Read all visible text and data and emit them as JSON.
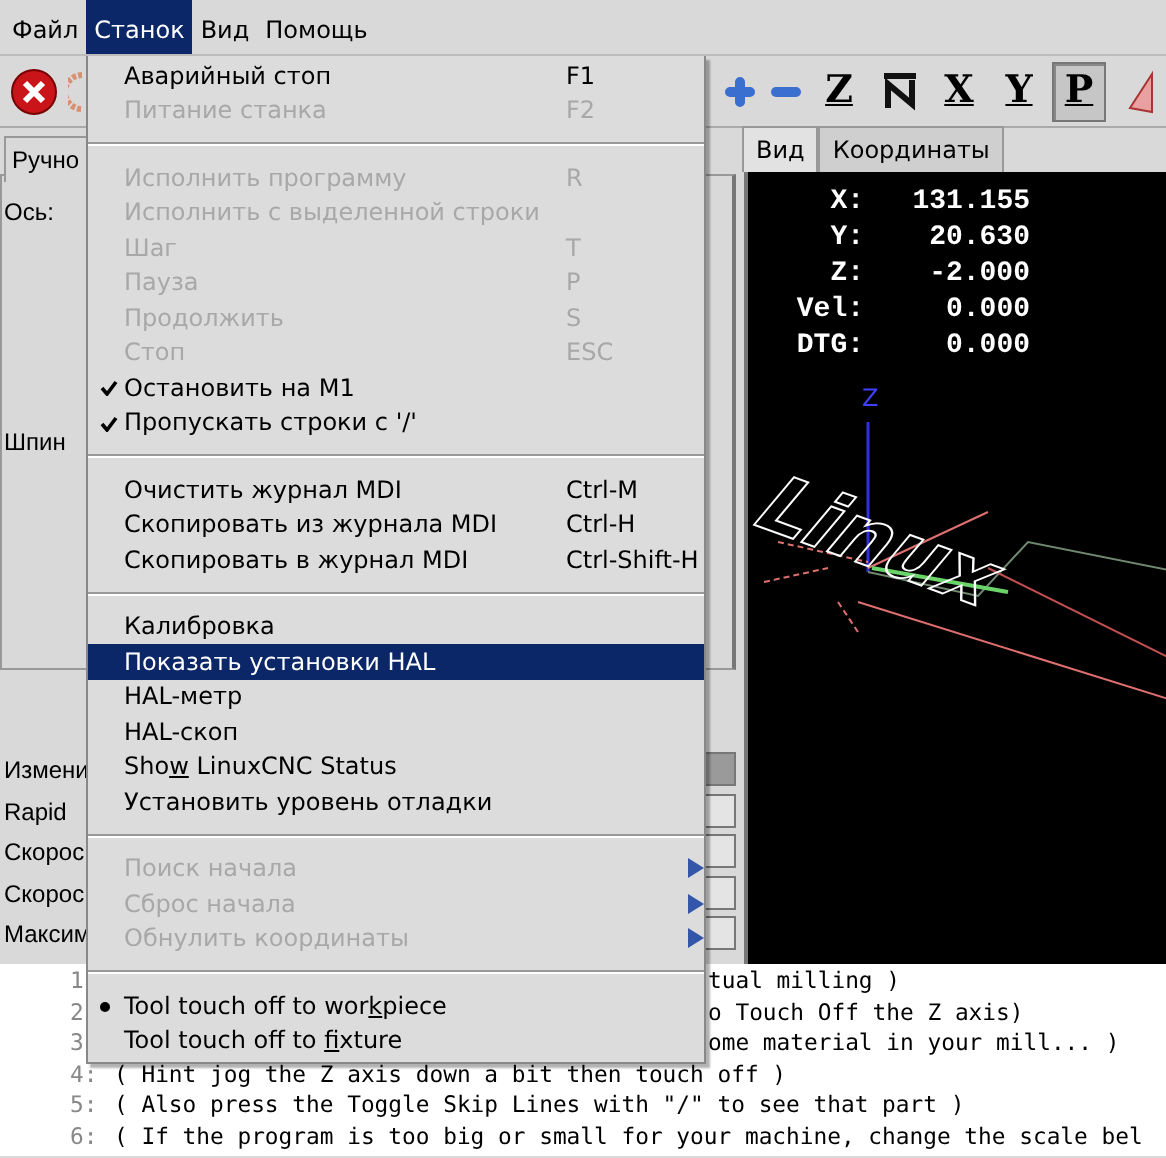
{
  "menubar": [
    {
      "label": "Файл",
      "selected": false
    },
    {
      "label": "Станок",
      "selected": true
    },
    {
      "label": "Вид",
      "selected": false
    },
    {
      "label": "Помощь",
      "selected": false
    }
  ],
  "toolbar": {
    "left": [
      {
        "kind": "estop"
      },
      {
        "kind": "power"
      }
    ],
    "right": [
      {
        "kind": "plus",
        "pressed": false
      },
      {
        "kind": "minus",
        "pressed": false
      },
      {
        "kind": "letter",
        "label": "Z",
        "pressed": false
      },
      {
        "kind": "rotated",
        "pressed": false
      },
      {
        "kind": "letter",
        "label": "X",
        "pressed": false
      },
      {
        "kind": "letter",
        "label": "Y",
        "pressed": false
      },
      {
        "kind": "letter",
        "label": "P",
        "pressed": true
      },
      {
        "kind": "cone",
        "pressed": false
      }
    ]
  },
  "left_panel": {
    "tab": "Ручно",
    "axis_label": "Ось:",
    "spindle_label": "Шпин",
    "sliders": [
      {
        "label": "Измени",
        "level": 1
      },
      {
        "label": "Rapid",
        "level": 0
      },
      {
        "label": "Скорос",
        "level": 0
      },
      {
        "label": "Скорос",
        "level": 0
      },
      {
        "label": "Максим",
        "level": 0
      }
    ]
  },
  "right_tabs": [
    {
      "label": "Вид",
      "selected": true
    },
    {
      "label": "Координаты",
      "selected": false
    }
  ],
  "dro": [
    {
      "axis": "X:",
      "value": "131.155"
    },
    {
      "axis": "Y:",
      "value": "20.630"
    },
    {
      "axis": "Z:",
      "value": "-2.000"
    },
    {
      "axis": "Vel:",
      "value": "0.000"
    },
    {
      "axis": "DTG:",
      "value": "0.000"
    }
  ],
  "preview": {
    "axis_label": "Z",
    "toolpath_text": "Linux"
  },
  "menu": [
    {
      "kind": "item",
      "label": "Аварийный стоп",
      "shortcut": "F1",
      "disabled": false,
      "selected": false
    },
    {
      "kind": "item",
      "label": "Питание станка",
      "shortcut": "F2",
      "disabled": true,
      "selected": false
    },
    {
      "kind": "separator"
    },
    {
      "kind": "item",
      "label": "Исполнить программу",
      "shortcut": "R",
      "disabled": true,
      "selected": false
    },
    {
      "kind": "item",
      "label": "Исполнить с выделенной строки",
      "disabled": true,
      "selected": false
    },
    {
      "kind": "item",
      "label": "Шаг",
      "shortcut": "T",
      "disabled": true,
      "selected": false
    },
    {
      "kind": "item",
      "label": "Пауза",
      "shortcut": "P",
      "disabled": true,
      "selected": false
    },
    {
      "kind": "item",
      "label": "Продолжить",
      "shortcut": "S",
      "disabled": true,
      "selected": false
    },
    {
      "kind": "item",
      "label": "Стоп",
      "shortcut": "ESC",
      "disabled": true,
      "selected": false
    },
    {
      "kind": "check",
      "label": "Остановить на M1",
      "checked": true,
      "disabled": false,
      "selected": false
    },
    {
      "kind": "check",
      "label": "Пропускать строки с '/'",
      "checked": true,
      "disabled": false,
      "selected": false
    },
    {
      "kind": "separator"
    },
    {
      "kind": "item",
      "label": "Очистить журнал MDI",
      "shortcut": "Ctrl-M",
      "disabled": false,
      "selected": false
    },
    {
      "kind": "item",
      "label": "Скопировать из журнала MDI",
      "shortcut": "Ctrl-H",
      "disabled": false,
      "selected": false
    },
    {
      "kind": "item",
      "label": "Скопировать в журнал MDI",
      "shortcut": "Ctrl-Shift-H",
      "disabled": false,
      "selected": false
    },
    {
      "kind": "separator"
    },
    {
      "kind": "item",
      "label": "Калибровка",
      "disabled": false,
      "selected": false
    },
    {
      "kind": "item",
      "label": "Показать установки HAL",
      "disabled": false,
      "selected": true
    },
    {
      "kind": "item",
      "label": "HAL-метр",
      "disabled": false,
      "selected": false
    },
    {
      "kind": "item",
      "label": "HAL-скоп",
      "disabled": false,
      "selected": false
    },
    {
      "kind": "item",
      "mnemonic": {
        "before": "Sho",
        "key": "w",
        "after": " LinuxCNC Status"
      },
      "disabled": false,
      "selected": false
    },
    {
      "kind": "item",
      "label": "Установить уровень отладки",
      "disabled": false,
      "selected": false
    },
    {
      "kind": "separator"
    },
    {
      "kind": "submenu",
      "label": "Поиск начала",
      "disabled": true,
      "selected": false
    },
    {
      "kind": "submenu",
      "label": "Сброс начала",
      "disabled": true,
      "selected": false
    },
    {
      "kind": "submenu",
      "label": "Обнулить координаты",
      "disabled": true,
      "selected": false
    },
    {
      "kind": "separator"
    },
    {
      "kind": "radio",
      "mnemonic": {
        "before": "Tool touch off to wor",
        "key": "k",
        "after": "piece"
      },
      "checked": true,
      "disabled": false,
      "selected": false
    },
    {
      "kind": "radio",
      "mnemonic": {
        "before": "Tool touch off to ",
        "key": "f",
        "after": "ixture"
      },
      "checked": false,
      "disabled": false,
      "selected": false
    }
  ],
  "code_lines": [
    {
      "kind": "partial",
      "number": "1",
      "text": "tual milling )"
    },
    {
      "kind": "partial",
      "number": "2",
      "text": "o Touch Off the Z axis)"
    },
    {
      "kind": "partial",
      "number": "3",
      "text": "ome material in your mill... )"
    },
    {
      "kind": "full",
      "number": "4:",
      "text": "( Hint jog the Z axis down a bit then touch off )"
    },
    {
      "kind": "full",
      "number": "5:",
      "text": "( Also press the Toggle Skip Lines with \"/\" to see that part )"
    },
    {
      "kind": "full",
      "number": "6:",
      "text": "( If the program is too big or small for your machine, change the scale bel"
    }
  ]
}
